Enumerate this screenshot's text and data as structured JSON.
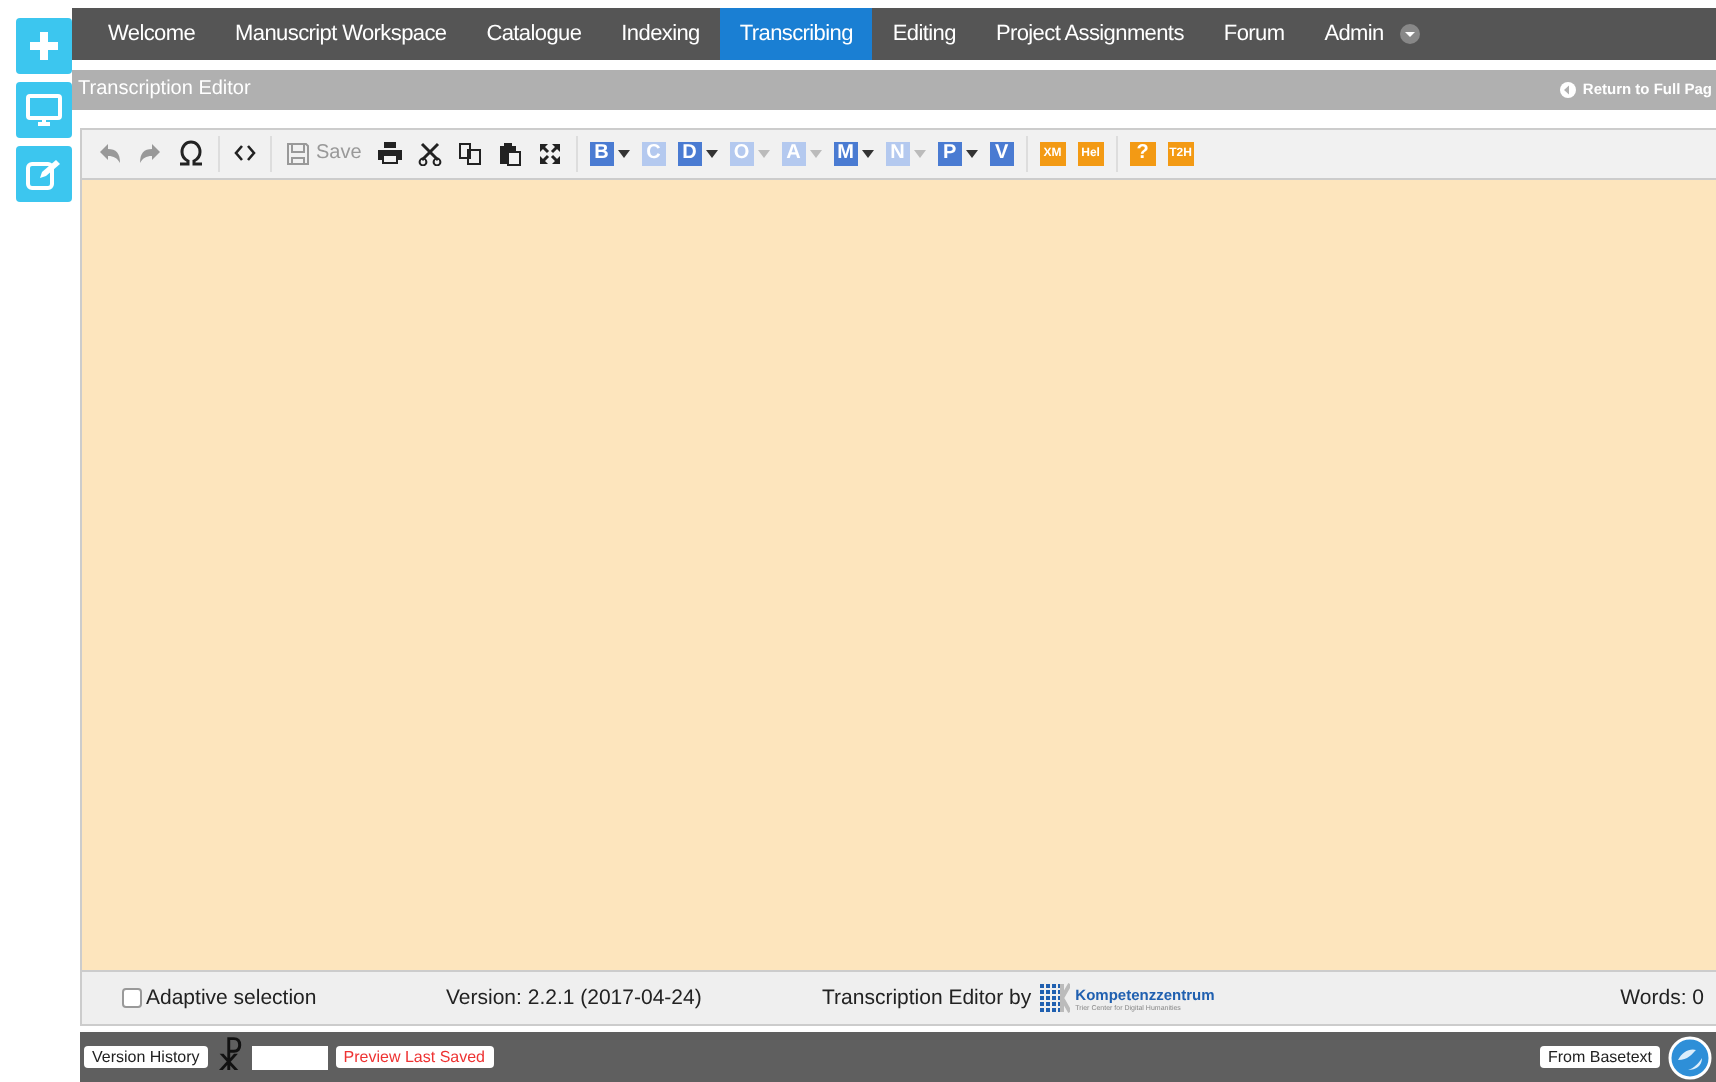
{
  "sidebar": {
    "buttons": [
      {
        "kind": "plus"
      },
      {
        "kind": "monitor"
      },
      {
        "kind": "edit"
      }
    ]
  },
  "nav": {
    "items": [
      {
        "label": "Welcome",
        "selected": false
      },
      {
        "label": "Manuscript Workspace",
        "selected": false
      },
      {
        "label": "Catalogue",
        "selected": false
      },
      {
        "label": "Indexing",
        "selected": false
      },
      {
        "label": "Transcribing",
        "selected": true
      },
      {
        "label": "Editing",
        "selected": false
      },
      {
        "label": "Project Assignments",
        "selected": false
      },
      {
        "label": "Forum",
        "selected": false
      },
      {
        "label": "Admin",
        "selected": false
      }
    ]
  },
  "title_bar": {
    "title": "Transcription Editor",
    "return_link": "Return to Full Pag"
  },
  "toolbar": {
    "tools": [
      {
        "kind": "undo",
        "disabled": true
      },
      {
        "kind": "redo",
        "disabled": true
      },
      {
        "kind": "omega",
        "disabled": false
      },
      {
        "kind": "sep"
      },
      {
        "kind": "source",
        "disabled": false
      },
      {
        "kind": "sep"
      },
      {
        "kind": "save",
        "disabled": true,
        "label": "Save"
      },
      {
        "kind": "print",
        "disabled": false
      },
      {
        "kind": "cut",
        "disabled": false
      },
      {
        "kind": "copy",
        "disabled": false
      },
      {
        "kind": "paste",
        "disabled": false
      },
      {
        "kind": "maximize",
        "disabled": false
      },
      {
        "kind": "sep"
      }
    ],
    "tag_buttons": [
      {
        "label": "B",
        "disabled": false,
        "dropdown": true
      },
      {
        "label": "C",
        "disabled": true,
        "dropdown": false
      },
      {
        "label": "D",
        "disabled": false,
        "dropdown": true
      },
      {
        "label": "O",
        "disabled": true,
        "dropdown": true
      },
      {
        "label": "A",
        "disabled": true,
        "dropdown": true
      },
      {
        "label": "M",
        "disabled": false,
        "dropdown": true
      },
      {
        "label": "N",
        "disabled": true,
        "dropdown": true
      },
      {
        "label": "P",
        "disabled": false,
        "dropdown": true
      },
      {
        "label": "V",
        "disabled": false,
        "dropdown": false
      }
    ],
    "orange_buttons": [
      {
        "label": "XM"
      },
      {
        "label": "Hel"
      },
      {
        "kind": "sep"
      },
      {
        "label": "?"
      },
      {
        "label": "T2H"
      }
    ]
  },
  "footer": {
    "adaptive_selection": {
      "label": "Adaptive selection",
      "checked": false
    },
    "version": "Version: 2.2.1 (2017-04-24)",
    "credit": "Transcription Editor by",
    "logo_name": "Kompetenzzentrum",
    "logo_subtitle": "Trier Center for Digital Humanities",
    "words": "Words: 0"
  },
  "bottom_bar": {
    "version_history": "Version History",
    "symbol": "☧",
    "preview": "Preview Last Saved",
    "from_basetext": "From Basetext"
  }
}
